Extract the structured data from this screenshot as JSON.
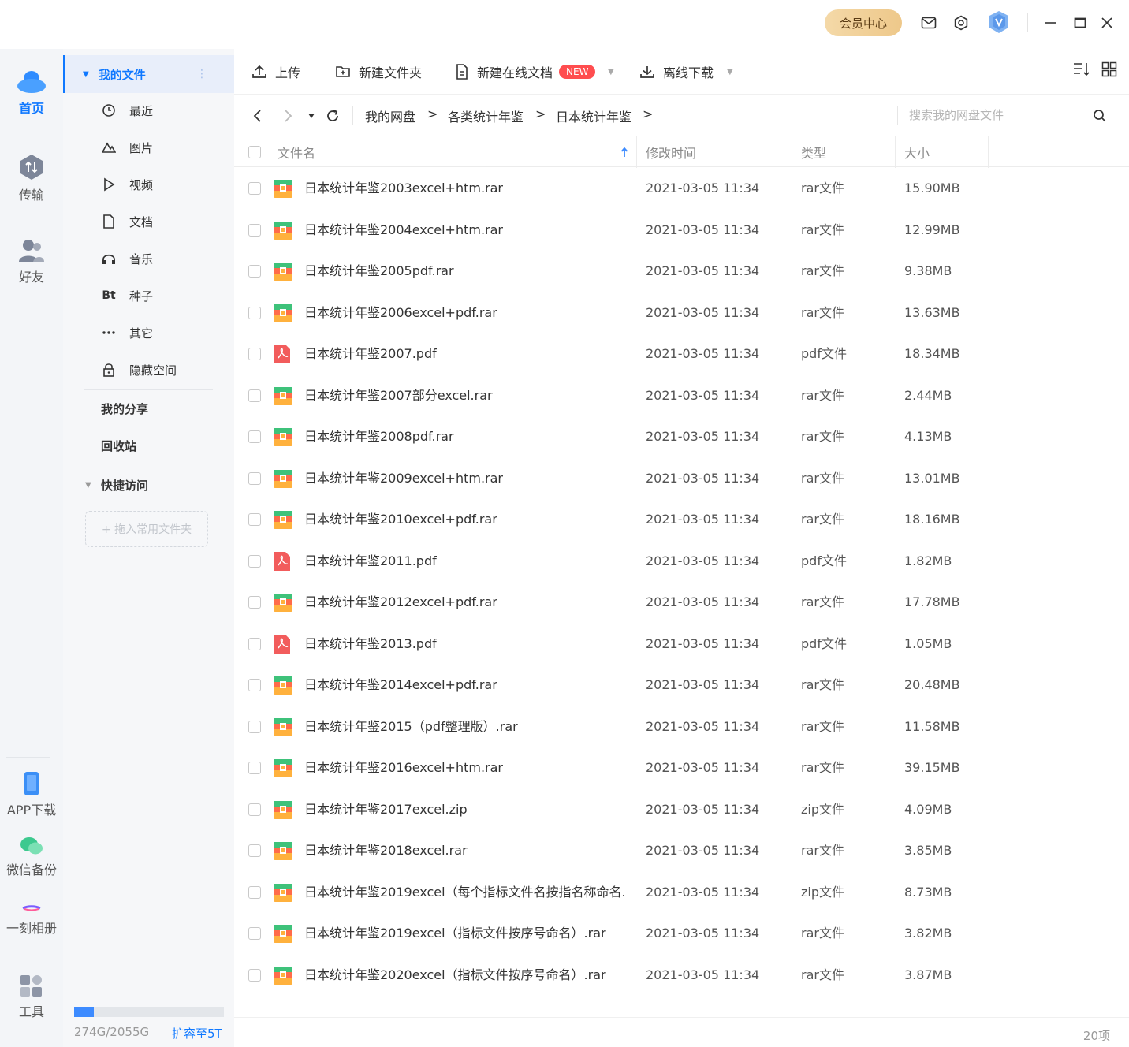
{
  "window": {
    "vip_label": "会员中心",
    "accent": "#0f78ff"
  },
  "rail": {
    "items": [
      {
        "label": "首页",
        "icon": "cloud-icon"
      },
      {
        "label": "传输",
        "icon": "transfer-icon"
      },
      {
        "label": "好友",
        "icon": "friends-icon"
      }
    ],
    "bottom": [
      {
        "label": "APP下载",
        "icon": "phone-icon"
      },
      {
        "label": "微信备份",
        "icon": "wechat-icon"
      },
      {
        "label": "一刻相册",
        "icon": "album-icon"
      },
      {
        "label": "工具",
        "icon": "tools-icon"
      }
    ]
  },
  "sidebar": {
    "my_files": "我的文件",
    "categories": [
      {
        "label": "最近",
        "icon": "clock-icon"
      },
      {
        "label": "图片",
        "icon": "image-icon"
      },
      {
        "label": "视频",
        "icon": "play-icon"
      },
      {
        "label": "文档",
        "icon": "document-icon"
      },
      {
        "label": "音乐",
        "icon": "headphones-icon"
      },
      {
        "label": "种子",
        "icon": "bt-icon",
        "glyph": "Bt"
      },
      {
        "label": "其它",
        "icon": "more-icon"
      },
      {
        "label": "隐藏空间",
        "icon": "lock-icon"
      }
    ],
    "my_share": "我的分享",
    "recycle": "回收站",
    "quick_access": "快捷访问",
    "drop_hint": "+ 拖入常用文件夹",
    "quota_text": "274G/2055G",
    "quota_fraction": 0.133,
    "expand_label": "扩容至5T"
  },
  "toolbar": {
    "upload": "上传",
    "new_folder": "新建文件夹",
    "new_online_doc": "新建在线文档",
    "new_badge": "NEW",
    "offline_download": "离线下载"
  },
  "breadcrumb": [
    "我的网盘",
    "各类统计年鉴",
    "日本统计年鉴"
  ],
  "breadcrumb_sep": ">",
  "search": {
    "placeholder": "搜索我的网盘文件"
  },
  "table": {
    "headers": {
      "name": "文件名",
      "modified": "修改时间",
      "type": "类型",
      "size": "大小"
    },
    "rows": [
      {
        "name": "日本统计年鉴2003excel+htm.rar",
        "date": "2021-03-05 11:34",
        "type": "rar文件",
        "size": "15.90MB",
        "kind": "archive"
      },
      {
        "name": "日本统计年鉴2004excel+htm.rar",
        "date": "2021-03-05 11:34",
        "type": "rar文件",
        "size": "12.99MB",
        "kind": "archive"
      },
      {
        "name": "日本统计年鉴2005pdf.rar",
        "date": "2021-03-05 11:34",
        "type": "rar文件",
        "size": "9.38MB",
        "kind": "archive"
      },
      {
        "name": "日本统计年鉴2006excel+pdf.rar",
        "date": "2021-03-05 11:34",
        "type": "rar文件",
        "size": "13.63MB",
        "kind": "archive"
      },
      {
        "name": "日本统计年鉴2007.pdf",
        "date": "2021-03-05 11:34",
        "type": "pdf文件",
        "size": "18.34MB",
        "kind": "pdf"
      },
      {
        "name": "日本统计年鉴2007部分excel.rar",
        "date": "2021-03-05 11:34",
        "type": "rar文件",
        "size": "2.44MB",
        "kind": "archive"
      },
      {
        "name": "日本统计年鉴2008pdf.rar",
        "date": "2021-03-05 11:34",
        "type": "rar文件",
        "size": "4.13MB",
        "kind": "archive"
      },
      {
        "name": "日本统计年鉴2009excel+htm.rar",
        "date": "2021-03-05 11:34",
        "type": "rar文件",
        "size": "13.01MB",
        "kind": "archive"
      },
      {
        "name": "日本统计年鉴2010excel+pdf.rar",
        "date": "2021-03-05 11:34",
        "type": "rar文件",
        "size": "18.16MB",
        "kind": "archive"
      },
      {
        "name": "日本统计年鉴2011.pdf",
        "date": "2021-03-05 11:34",
        "type": "pdf文件",
        "size": "1.82MB",
        "kind": "pdf"
      },
      {
        "name": "日本统计年鉴2012excel+pdf.rar",
        "date": "2021-03-05 11:34",
        "type": "rar文件",
        "size": "17.78MB",
        "kind": "archive"
      },
      {
        "name": "日本统计年鉴2013.pdf",
        "date": "2021-03-05 11:34",
        "type": "pdf文件",
        "size": "1.05MB",
        "kind": "pdf"
      },
      {
        "name": "日本统计年鉴2014excel+pdf.rar",
        "date": "2021-03-05 11:34",
        "type": "rar文件",
        "size": "20.48MB",
        "kind": "archive"
      },
      {
        "name": "日本统计年鉴2015（pdf整理版）.rar",
        "date": "2021-03-05 11:34",
        "type": "rar文件",
        "size": "11.58MB",
        "kind": "archive"
      },
      {
        "name": "日本统计年鉴2016excel+htm.rar",
        "date": "2021-03-05 11:34",
        "type": "rar文件",
        "size": "39.15MB",
        "kind": "archive"
      },
      {
        "name": "日本统计年鉴2017excel.zip",
        "date": "2021-03-05 11:34",
        "type": "zip文件",
        "size": "4.09MB",
        "kind": "archive"
      },
      {
        "name": "日本统计年鉴2018excel.rar",
        "date": "2021-03-05 11:34",
        "type": "rar文件",
        "size": "3.85MB",
        "kind": "archive"
      },
      {
        "name": "日本统计年鉴2019excel（每个指标文件名按指名称命名...",
        "date": "2021-03-05 11:34",
        "type": "zip文件",
        "size": "8.73MB",
        "kind": "archive"
      },
      {
        "name": "日本统计年鉴2019excel（指标文件按序号命名）.rar",
        "date": "2021-03-05 11:34",
        "type": "rar文件",
        "size": "3.82MB",
        "kind": "archive"
      },
      {
        "name": "日本统计年鉴2020excel（指标文件按序号命名）.rar",
        "date": "2021-03-05 11:34",
        "type": "rar文件",
        "size": "3.87MB",
        "kind": "archive"
      }
    ]
  },
  "status": {
    "count": "20项"
  }
}
